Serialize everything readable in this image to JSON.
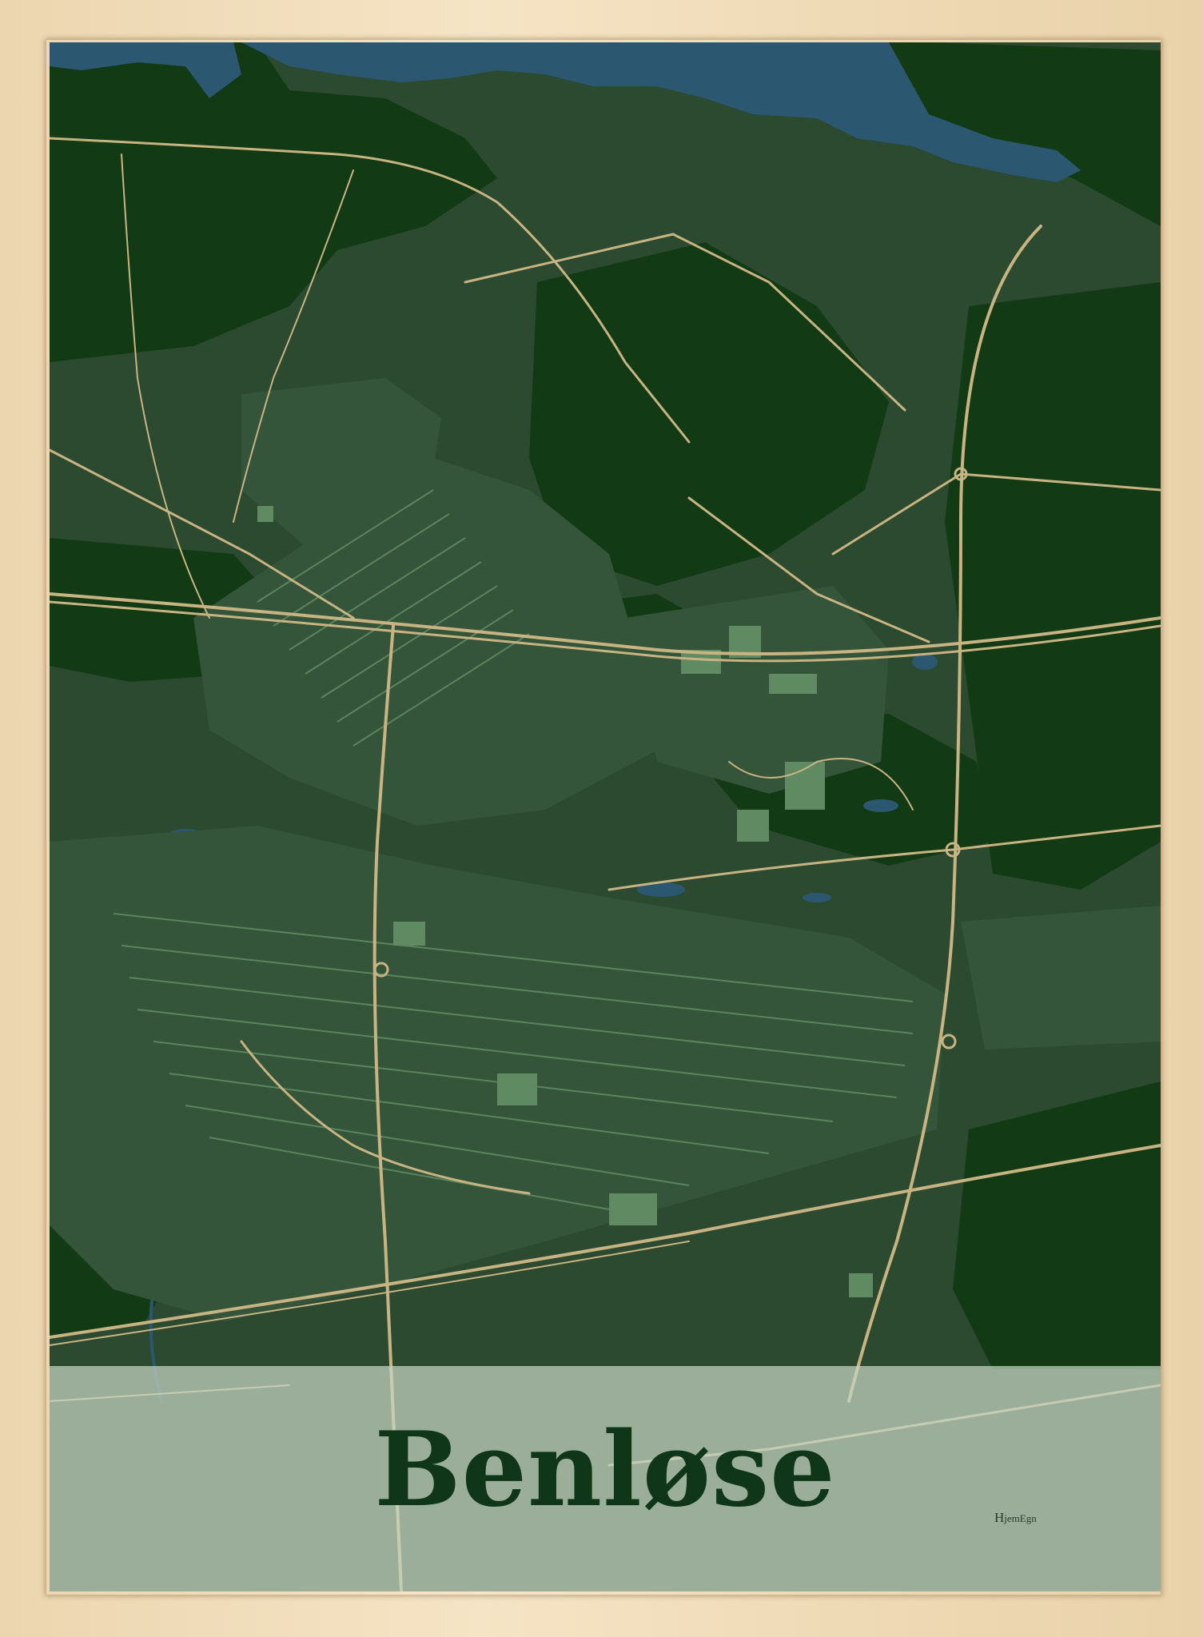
{
  "poster": {
    "title": "Benløse",
    "brand_initial": "H",
    "brand_rest": "jemEgn"
  },
  "colors": {
    "frame": "#f0dcb8",
    "land": "#2c4a2f",
    "forest": "#123a14",
    "water": "#2b5870",
    "roads": "#c8b482",
    "buildings": "#5f8a62",
    "label_band": "#c5d6c4",
    "title_text": "#10361a"
  }
}
